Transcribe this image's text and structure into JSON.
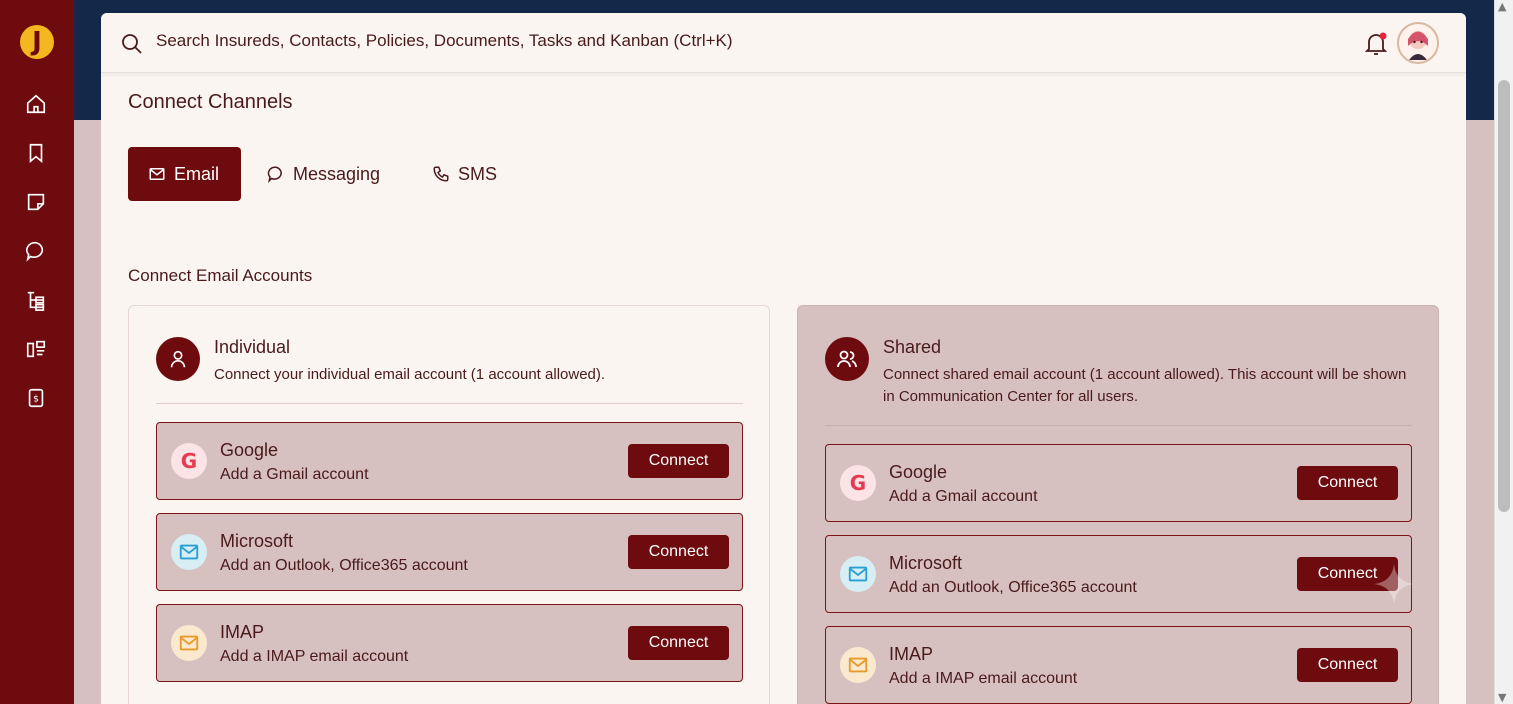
{
  "search": {
    "placeholder": "Search Insureds, Contacts, Policies, Documents, Tasks and Kanban (Ctrl+K)"
  },
  "page": {
    "title": "Connect Channels",
    "section_title": "Connect Email Accounts"
  },
  "tabs": [
    {
      "label": "Email",
      "icon": "mail-icon",
      "active": true
    },
    {
      "label": "Messaging",
      "icon": "chat-bubble-icon",
      "active": false
    },
    {
      "label": "SMS",
      "icon": "phone-icon",
      "active": false
    }
  ],
  "cards": {
    "individual": {
      "title": "Individual",
      "description": "Connect your individual email account (1 account allowed).",
      "providers": [
        {
          "name": "Google",
          "subtitle": "Add a Gmail account",
          "button": "Connect"
        },
        {
          "name": "Microsoft",
          "subtitle": "Add an Outlook, Office365 account",
          "button": "Connect"
        },
        {
          "name": "IMAP",
          "subtitle": "Add a IMAP email account",
          "button": "Connect"
        }
      ]
    },
    "shared": {
      "title": "Shared",
      "description": "Connect shared email account (1 account allowed). This account will be shown in Communication Center for all users.",
      "providers": [
        {
          "name": "Google",
          "subtitle": "Add a Gmail account",
          "button": "Connect"
        },
        {
          "name": "Microsoft",
          "subtitle": "Add an Outlook, Office365 account",
          "button": "Connect"
        },
        {
          "name": "IMAP",
          "subtitle": "Add a IMAP email account",
          "button": "Connect"
        }
      ]
    }
  },
  "sidebar": {
    "items": [
      "home-icon",
      "bookmark-icon",
      "sticky-note-icon",
      "chat-icon",
      "hierarchy-icon",
      "kanban-icon",
      "receipt-icon"
    ]
  },
  "colors": {
    "brand": "#6e0b0e",
    "panel": "#faf5f0",
    "card_bg": "#d7c0c0",
    "top_band": "#14294a"
  }
}
